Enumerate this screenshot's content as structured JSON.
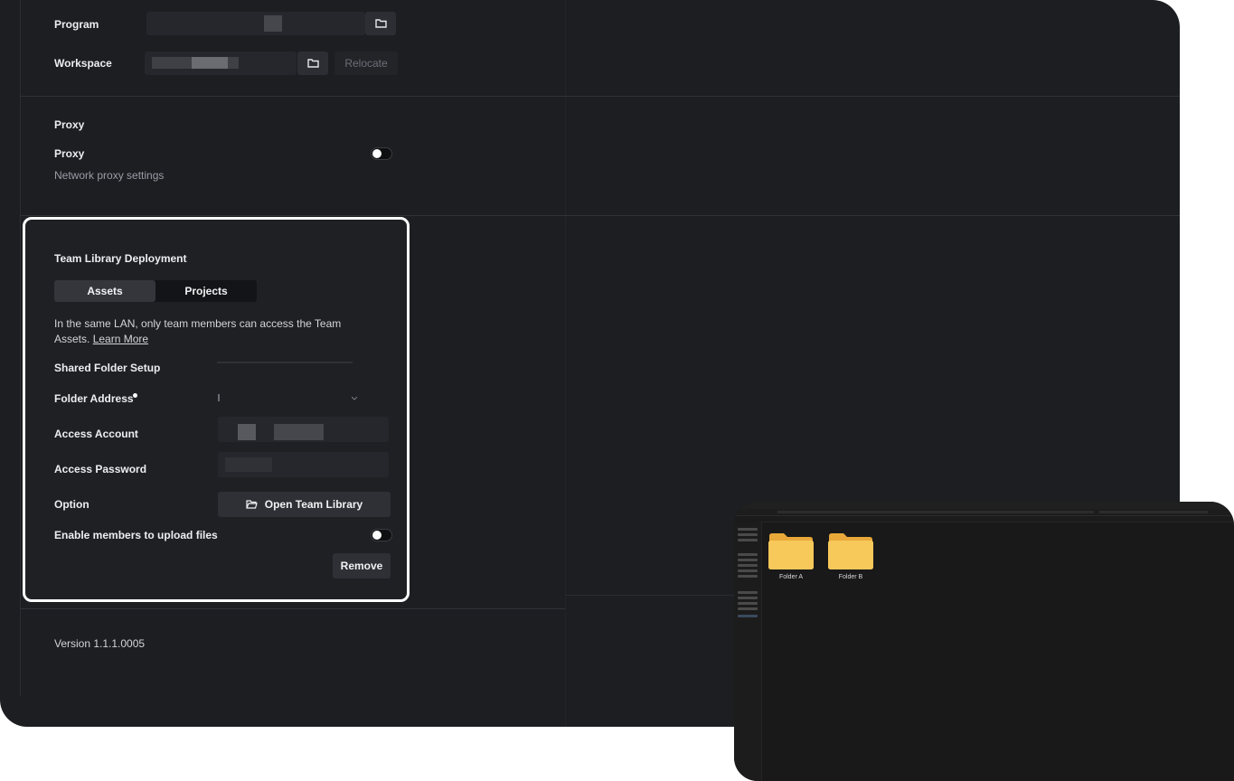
{
  "settings": {
    "program": {
      "label": "Program"
    },
    "workspace": {
      "label": "Workspace",
      "relocate_label": "Relocate"
    },
    "proxy": {
      "section_title": "Proxy",
      "toggle_label": "Proxy",
      "description": "Network proxy settings",
      "enabled": false
    },
    "team_library": {
      "title": "Team Library Deployment",
      "tabs": [
        {
          "label": "Assets",
          "active": true
        },
        {
          "label": "Projects",
          "active": false
        }
      ],
      "description": "In the same LAN, only team members can access the Team Assets.",
      "learn_more": "Learn More",
      "shared_folder_setup": "Shared Folder Setup",
      "folder_address_label": "Folder Address",
      "access_account_label": "Access Account",
      "access_password_label": "Access Password",
      "option_label": "Option",
      "open_button": "Open Team Library",
      "upload_label": "Enable members to upload files",
      "upload_enabled": false,
      "remove_button": "Remove"
    },
    "version": "Version 1.1.1.0005"
  },
  "explorer": {
    "folders": [
      {
        "name": "Folder A"
      },
      {
        "name": "Folder B"
      }
    ]
  },
  "colors": {
    "window_bg": "#1c1e22",
    "card_border": "#ffffff",
    "folder_yellow": "#f5c451"
  }
}
